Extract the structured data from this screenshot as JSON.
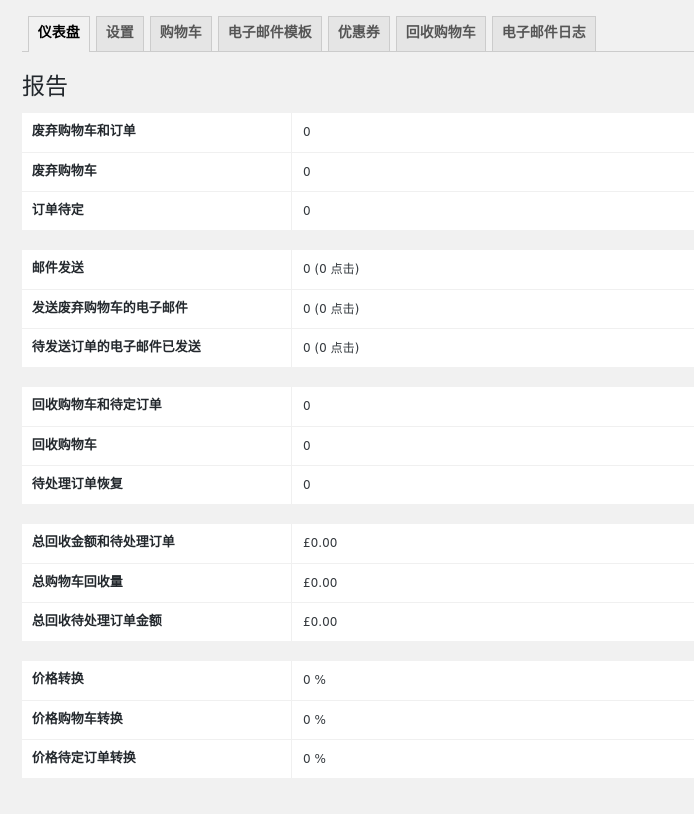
{
  "tabs": [
    {
      "label": "仪表盘",
      "active": true
    },
    {
      "label": "设置",
      "active": false
    },
    {
      "label": "购物车",
      "active": false
    },
    {
      "label": "电子邮件模板",
      "active": false
    },
    {
      "label": "优惠券",
      "active": false
    },
    {
      "label": "回收购物车",
      "active": false
    },
    {
      "label": "电子邮件日志",
      "active": false
    }
  ],
  "page_title": "报告",
  "groups": [
    {
      "rows": [
        {
          "label": "废弃购物车和订单",
          "value": "0"
        },
        {
          "label": "废弃购物车",
          "value": "0"
        },
        {
          "label": "订单待定",
          "value": "0"
        }
      ]
    },
    {
      "rows": [
        {
          "label": "邮件发送",
          "value": "0 (0 点击)"
        },
        {
          "label": "发送废弃购物车的电子邮件",
          "value": "0 (0 点击)"
        },
        {
          "label": "待发送订单的电子邮件已发送",
          "value": "0 (0 点击)"
        }
      ]
    },
    {
      "rows": [
        {
          "label": "回收购物车和待定订单",
          "value": "0"
        },
        {
          "label": "回收购物车",
          "value": "0"
        },
        {
          "label": "待处理订单恢复",
          "value": "0"
        }
      ]
    },
    {
      "rows": [
        {
          "label": "总回收金额和待处理订单",
          "value": "£0.00"
        },
        {
          "label": "总购物车回收量",
          "value": "£0.00"
        },
        {
          "label": "总回收待处理订单金额",
          "value": "£0.00"
        }
      ]
    },
    {
      "rows": [
        {
          "label": "价格转换",
          "value": "0 %"
        },
        {
          "label": "价格购物车转换",
          "value": "0 %"
        },
        {
          "label": "价格待定订单转换",
          "value": "0 %"
        }
      ]
    }
  ]
}
